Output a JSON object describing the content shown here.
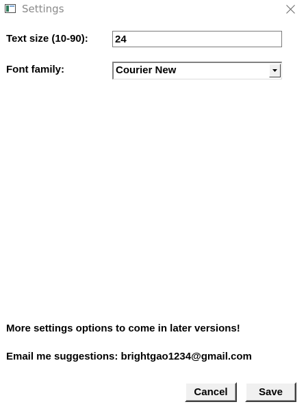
{
  "window": {
    "title": "Settings",
    "icons": {
      "app": "window-icon",
      "close": "close-icon"
    }
  },
  "form": {
    "text_size": {
      "label": "Text size (10-90):",
      "value": "24"
    },
    "font_family": {
      "label": "Font family:",
      "selected": "Courier New",
      "dropdown_icon": "chevron-down-icon"
    }
  },
  "info": {
    "more_settings": "More settings options to come in later versions!",
    "email": "Email me suggestions: brightgao1234@gmail.com"
  },
  "buttons": {
    "cancel": "Cancel",
    "save": "Save"
  }
}
